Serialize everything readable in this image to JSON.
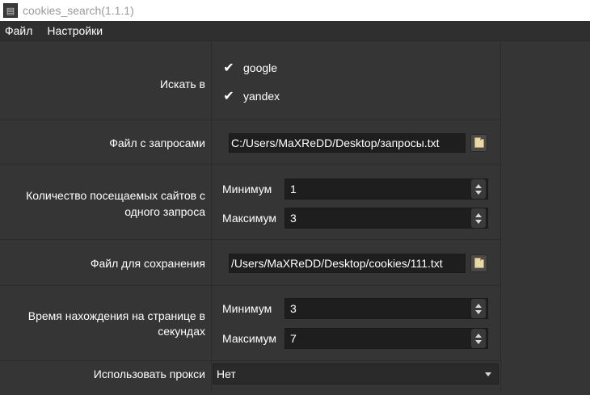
{
  "window": {
    "title": "cookies_search(1.1.1)",
    "icon": "app-icon"
  },
  "menu": [
    {
      "label": "Файл"
    },
    {
      "label": "Настройки"
    }
  ],
  "search_in": {
    "label": "Искать в",
    "options": [
      {
        "label": "google",
        "checked": true
      },
      {
        "label": "yandex",
        "checked": true
      }
    ]
  },
  "queries_file": {
    "label": "Файл с запросами",
    "value": "C:/Users/MaXReDD/Desktop/запросы.txt",
    "browse_icon": "folder-icon"
  },
  "sites_per_query": {
    "label_line1": "Количество посещаемых сайтов с",
    "label_line2": "одного запроса",
    "min_label": "Минимум",
    "min_value": "1",
    "max_label": "Максимум",
    "max_value": "3"
  },
  "save_file": {
    "label": "Файл для сохранения",
    "value": "/Users/MaXReDD/Desktop/cookies/111.txt",
    "browse_icon": "folder-icon"
  },
  "time_on_page": {
    "label_line1": "Время нахождения на странице в",
    "label_line2": "секундах",
    "min_label": "Минимум",
    "min_value": "3",
    "max_label": "Максимум",
    "max_value": "7"
  },
  "proxy": {
    "label": "Использовать прокси",
    "value": "Нет"
  },
  "colors": {
    "background": "#353535",
    "input_background": "#1e1e1e",
    "text": "#ffffff"
  }
}
